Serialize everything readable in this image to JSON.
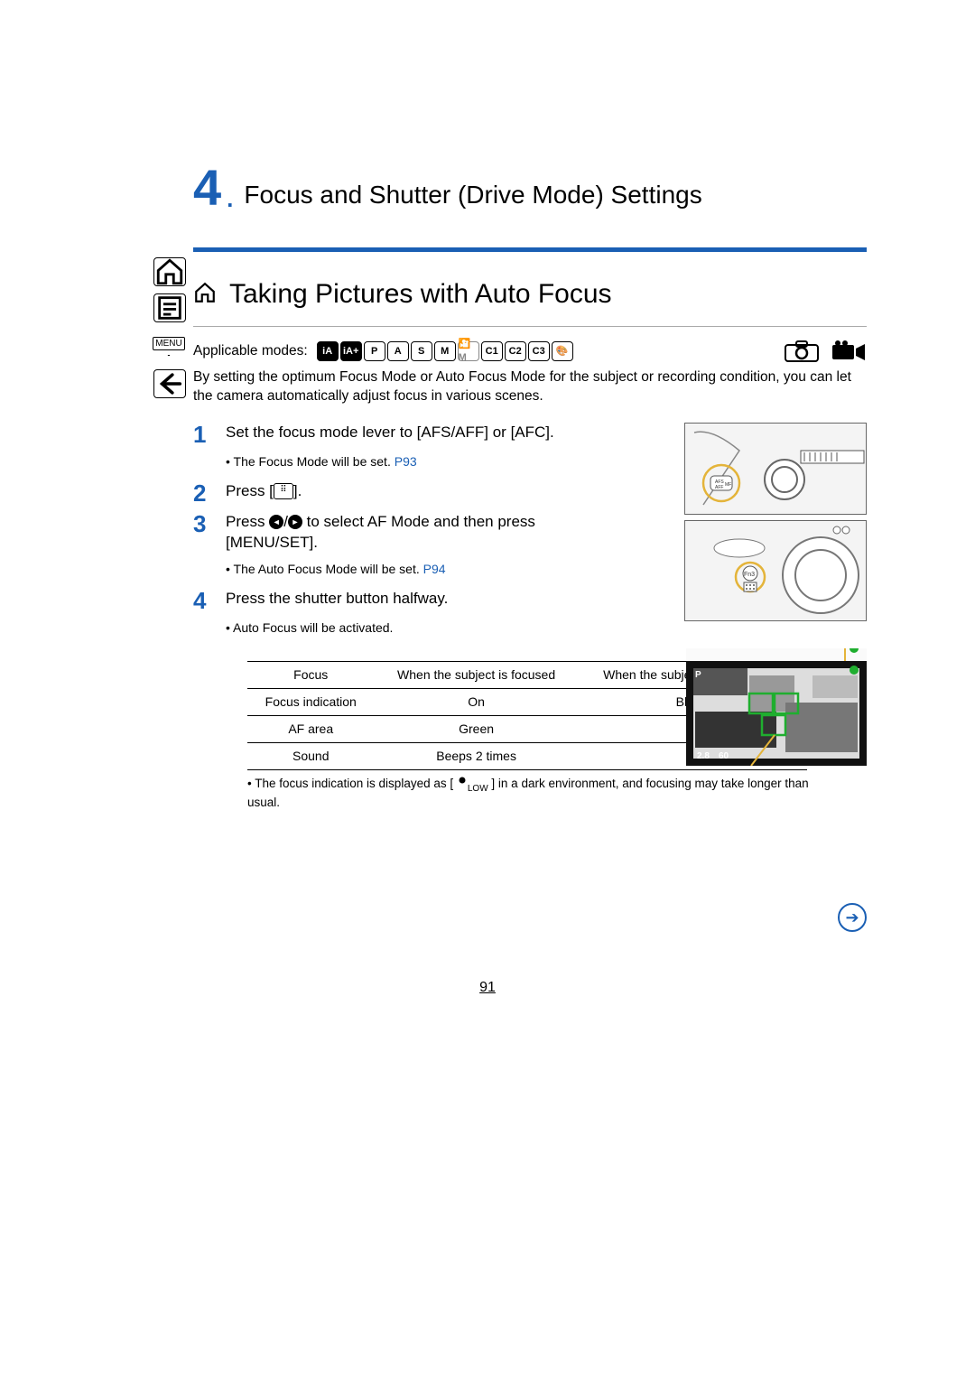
{
  "chapter": {
    "number": "4",
    "dot": ".",
    "title": "Focus and Shutter (Drive Mode) Settings"
  },
  "section": {
    "title": "Taking Pictures with Auto Focus"
  },
  "modes": {
    "label": "Applicable modes:",
    "badges": [
      "iA",
      "iA+",
      "P",
      "A",
      "S",
      "M",
      "🎦M",
      "C1",
      "C2",
      "C3",
      "🎨"
    ]
  },
  "intro": "By setting the optimum Focus Mode or Auto Focus Mode for the subject or recording condition, you can let the camera automatically adjust focus in various scenes.",
  "steps": {
    "s1": {
      "num": "1",
      "text": "Set the focus mode lever to [AFS/AFF] or [AFC].",
      "note_prefix": "• The Focus Mode will be set. ",
      "note_link": "P93"
    },
    "s2": {
      "num": "2",
      "text_before": "Press [",
      "text_after": "]."
    },
    "s3": {
      "num": "3",
      "text_before": "Press ",
      "text_mid": " to select AF Mode and then press [MENU/SET].",
      "note_prefix": "• The Auto Focus Mode will be set. ",
      "note_link": "P94"
    },
    "s4": {
      "num": "4",
      "text": "Press the shutter button halfway.",
      "note": "• Auto Focus will be activated."
    }
  },
  "table": {
    "h1": "Focus",
    "h2": "When the subject is focused",
    "h3": "When the subject is not focused",
    "r1c1": "Focus indication",
    "r1c2": "On",
    "r1c3": "Blinks",
    "r2c1": "AF area",
    "r2c2": "Green",
    "r2c3": "—",
    "r3c1": "Sound",
    "r3c2": "Beeps 2 times",
    "r3c3": "—"
  },
  "table_note_before": "• The focus indication is displayed as [",
  "table_note_low": "LOW",
  "table_note_after": "] in a dark environment, and focusing may take longer than usual.",
  "sidebar": {
    "menu": "MENU"
  },
  "illus2_label": "Fn3",
  "illus3_labels": {
    "mode": "P",
    "aperture": "2.8",
    "shutter": "60"
  },
  "page_number": "91"
}
